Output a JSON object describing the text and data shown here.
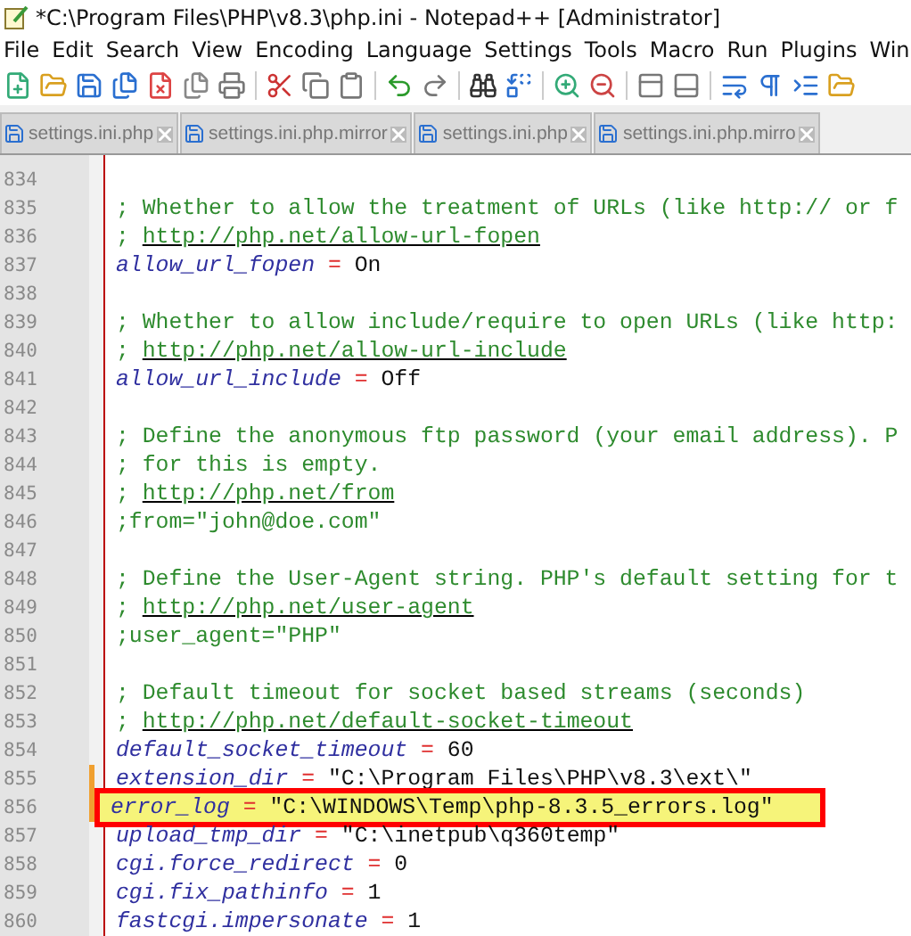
{
  "window": {
    "title": "*C:\\Program Files\\PHP\\v8.3\\php.ini - Notepad++ [Administrator]"
  },
  "menu": [
    "File",
    "Edit",
    "Search",
    "View",
    "Encoding",
    "Language",
    "Settings",
    "Tools",
    "Macro",
    "Run",
    "Plugins",
    "Win"
  ],
  "tabs": [
    {
      "label": "settings.ini.php"
    },
    {
      "label": "settings.ini.php.mirror"
    },
    {
      "label": "settings.ini.php"
    },
    {
      "label": "settings.ini.php.mirro"
    }
  ],
  "lines": [
    {
      "num": "834",
      "modified": false,
      "highlighted": false
    },
    {
      "num": "835",
      "modified": false,
      "highlighted": false,
      "tokens": [
        {
          "kind": "comment",
          "text": "; Whether to allow the treatment of URLs (like http:// or f"
        }
      ]
    },
    {
      "num": "836",
      "modified": false,
      "highlighted": false,
      "tokens": [
        {
          "kind": "comment",
          "text": "; "
        },
        {
          "kind": "link",
          "text": "http://php.net/allow-url-fopen"
        }
      ]
    },
    {
      "num": "837",
      "modified": false,
      "highlighted": false,
      "tokens": [
        {
          "kind": "key",
          "text": "allow_url_fopen"
        },
        {
          "kind": "op",
          "text": " = "
        },
        {
          "kind": "value",
          "text": "On"
        }
      ]
    },
    {
      "num": "838",
      "modified": false,
      "highlighted": false
    },
    {
      "num": "839",
      "modified": false,
      "highlighted": false,
      "tokens": [
        {
          "kind": "comment",
          "text": "; Whether to allow include/require to open URLs (like http:"
        }
      ]
    },
    {
      "num": "840",
      "modified": false,
      "highlighted": false,
      "tokens": [
        {
          "kind": "comment",
          "text": "; "
        },
        {
          "kind": "link",
          "text": "http://php.net/allow-url-include"
        }
      ]
    },
    {
      "num": "841",
      "modified": false,
      "highlighted": false,
      "tokens": [
        {
          "kind": "key",
          "text": "allow_url_include"
        },
        {
          "kind": "op",
          "text": " = "
        },
        {
          "kind": "value",
          "text": "Off"
        }
      ]
    },
    {
      "num": "842",
      "modified": false,
      "highlighted": false
    },
    {
      "num": "843",
      "modified": false,
      "highlighted": false,
      "tokens": [
        {
          "kind": "comment",
          "text": "; Define the anonymous ftp password (your email address). P"
        }
      ]
    },
    {
      "num": "844",
      "modified": false,
      "highlighted": false,
      "tokens": [
        {
          "kind": "comment",
          "text": "; for this is empty."
        }
      ]
    },
    {
      "num": "845",
      "modified": false,
      "highlighted": false,
      "tokens": [
        {
          "kind": "comment",
          "text": "; "
        },
        {
          "kind": "link",
          "text": "http://php.net/from"
        }
      ]
    },
    {
      "num": "846",
      "modified": false,
      "highlighted": false,
      "tokens": [
        {
          "kind": "comment",
          "text": ";from=\"john@doe.com\""
        }
      ]
    },
    {
      "num": "847",
      "modified": false,
      "highlighted": false
    },
    {
      "num": "848",
      "modified": false,
      "highlighted": false,
      "tokens": [
        {
          "kind": "comment",
          "text": "; Define the User-Agent string. PHP's default setting for t"
        }
      ]
    },
    {
      "num": "849",
      "modified": false,
      "highlighted": false,
      "tokens": [
        {
          "kind": "comment",
          "text": "; "
        },
        {
          "kind": "link",
          "text": "http://php.net/user-agent"
        }
      ]
    },
    {
      "num": "850",
      "modified": false,
      "highlighted": false,
      "tokens": [
        {
          "kind": "comment",
          "text": ";user_agent=\"PHP\""
        }
      ]
    },
    {
      "num": "851",
      "modified": false,
      "highlighted": false
    },
    {
      "num": "852",
      "modified": false,
      "highlighted": false,
      "tokens": [
        {
          "kind": "comment",
          "text": "; Default timeout for socket based streams (seconds)"
        }
      ]
    },
    {
      "num": "853",
      "modified": false,
      "highlighted": false,
      "tokens": [
        {
          "kind": "comment",
          "text": "; "
        },
        {
          "kind": "link",
          "text": "http://php.net/default-socket-timeout"
        }
      ]
    },
    {
      "num": "854",
      "modified": false,
      "highlighted": false,
      "tokens": [
        {
          "kind": "key",
          "text": "default_socket_timeout"
        },
        {
          "kind": "op",
          "text": " = "
        },
        {
          "kind": "value",
          "text": "60"
        }
      ]
    },
    {
      "num": "855",
      "modified": true,
      "highlighted": false,
      "tokens": [
        {
          "kind": "key",
          "text": "extension_dir"
        },
        {
          "kind": "op",
          "text": " = "
        },
        {
          "kind": "value",
          "text": "\"C:\\Program Files\\PHP\\v8.3\\ext\\\""
        }
      ]
    },
    {
      "num": "856",
      "modified": true,
      "highlighted": true,
      "tokens": [
        {
          "kind": "key",
          "text": "error_log"
        },
        {
          "kind": "op",
          "text": " = "
        },
        {
          "kind": "value",
          "text": "\"C:\\WINDOWS\\Temp\\php-8.3.5_errors.log\""
        }
      ]
    },
    {
      "num": "857",
      "modified": false,
      "highlighted": false,
      "tokens": [
        {
          "kind": "key",
          "text": "upload_tmp_dir"
        },
        {
          "kind": "op",
          "text": " = "
        },
        {
          "kind": "value",
          "text": "\"C:\\inetpub\\q360temp\""
        }
      ]
    },
    {
      "num": "858",
      "modified": false,
      "highlighted": false,
      "tokens": [
        {
          "kind": "key",
          "text": "cgi.force_redirect"
        },
        {
          "kind": "op",
          "text": " = "
        },
        {
          "kind": "value",
          "text": "0"
        }
      ]
    },
    {
      "num": "859",
      "modified": false,
      "highlighted": false,
      "tokens": [
        {
          "kind": "key",
          "text": "cgi.fix_pathinfo"
        },
        {
          "kind": "op",
          "text": " = "
        },
        {
          "kind": "value",
          "text": "1"
        }
      ]
    },
    {
      "num": "860",
      "modified": false,
      "highlighted": false,
      "tokens": [
        {
          "kind": "key",
          "text": "fastcgi.impersonate"
        },
        {
          "kind": "op",
          "text": " = "
        },
        {
          "kind": "value",
          "text": "1"
        }
      ]
    }
  ]
}
